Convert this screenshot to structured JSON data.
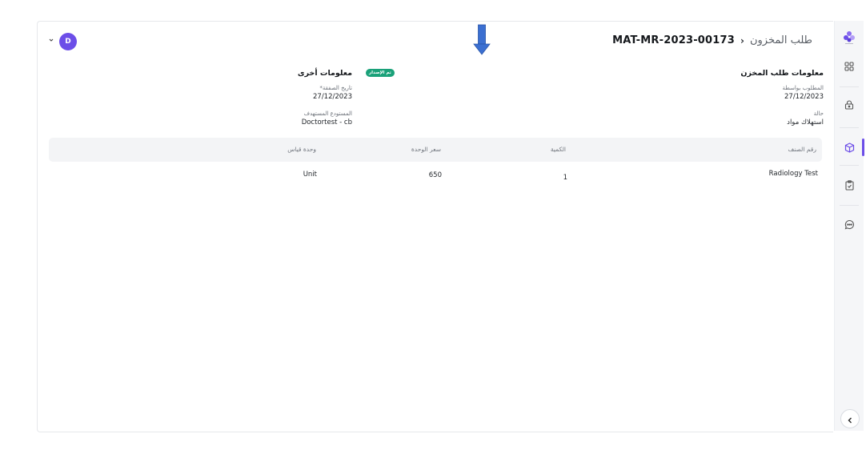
{
  "header": {
    "breadcrumb": "طلب المخزون",
    "separator": "›",
    "document_id": "MAT-MR-2023-00173",
    "avatar_initial": "D"
  },
  "request_info": {
    "section_title": "معلومات طلب المخزن",
    "required_by_label": "المطلوب بواسطة",
    "required_by_value": "27/12/2023",
    "status_label": "حالة",
    "status_value": "استهلاك مواد"
  },
  "other_info": {
    "section_title": "معلومات أخرى",
    "badge": "تم الإصدار",
    "transaction_date_label": "تاريخ الصفقة*",
    "transaction_date_value": "27/12/2023",
    "target_warehouse_label": "المستودع المستهدف",
    "target_warehouse_value": "Doctortest - cb"
  },
  "table": {
    "headers": {
      "item_code": "رقم الصنف",
      "qty": "الكمية",
      "unit_price": "سعر الوحدة",
      "uom": "وحدة قياس"
    },
    "rows": [
      {
        "item_code": "Radiology Test",
        "qty": "1",
        "unit_price": "650",
        "uom": "Unit"
      }
    ]
  },
  "colors": {
    "accent": "#6c4ee8",
    "badge": "#1aa179",
    "arrow": "#3b6fd1"
  },
  "sidebar": {
    "icons": [
      "logo-icon",
      "apps-grid-icon",
      "lock-icon",
      "box-icon",
      "clipboard-icon",
      "chat-icon",
      "chevron-left-icon"
    ],
    "active": "box-icon"
  }
}
